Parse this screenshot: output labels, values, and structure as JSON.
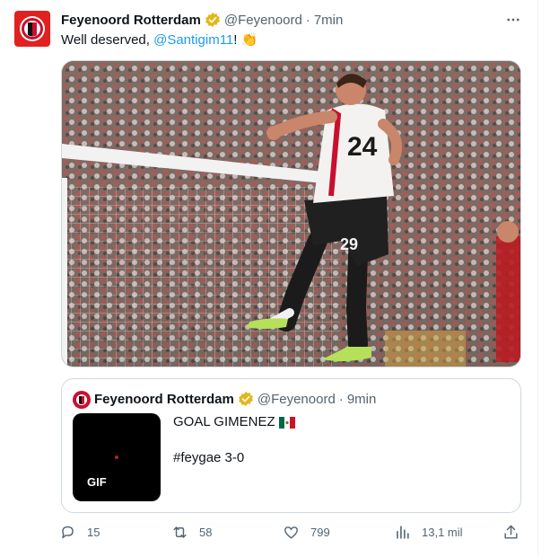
{
  "tweet": {
    "author_name": "Feyenoord Rotterdam",
    "handle": "@Feyenoord",
    "separator": "·",
    "time": "7min",
    "text_prefix": "Well deserved, ",
    "mention": "@Santigim11",
    "text_suffix": "! 👏",
    "media": {
      "jersey_back_number": "24",
      "shorts_number": "29"
    }
  },
  "quote": {
    "author_name": "Feyenoord Rotterdam",
    "handle": "@Feyenoord",
    "separator": "·",
    "time": "9min",
    "line1": "GOAL GIMENEZ",
    "line2": "#feygae 3-0",
    "gif_label": "GIF"
  },
  "actions": {
    "replies": "15",
    "retweets": "58",
    "likes": "799",
    "views": "13,1 mil"
  },
  "colors": {
    "brand_red": "#e1211f",
    "link_blue": "#1d9bf0",
    "verified_gold": "#e2b719",
    "muted": "#536471"
  },
  "icons": {
    "verified": "verified-badge-icon",
    "more": "more-dots-icon",
    "reply": "reply-icon",
    "retweet": "retweet-icon",
    "like": "heart-icon",
    "views": "views-chart-icon",
    "share": "share-icon",
    "flag": "mexico-flag-icon"
  }
}
